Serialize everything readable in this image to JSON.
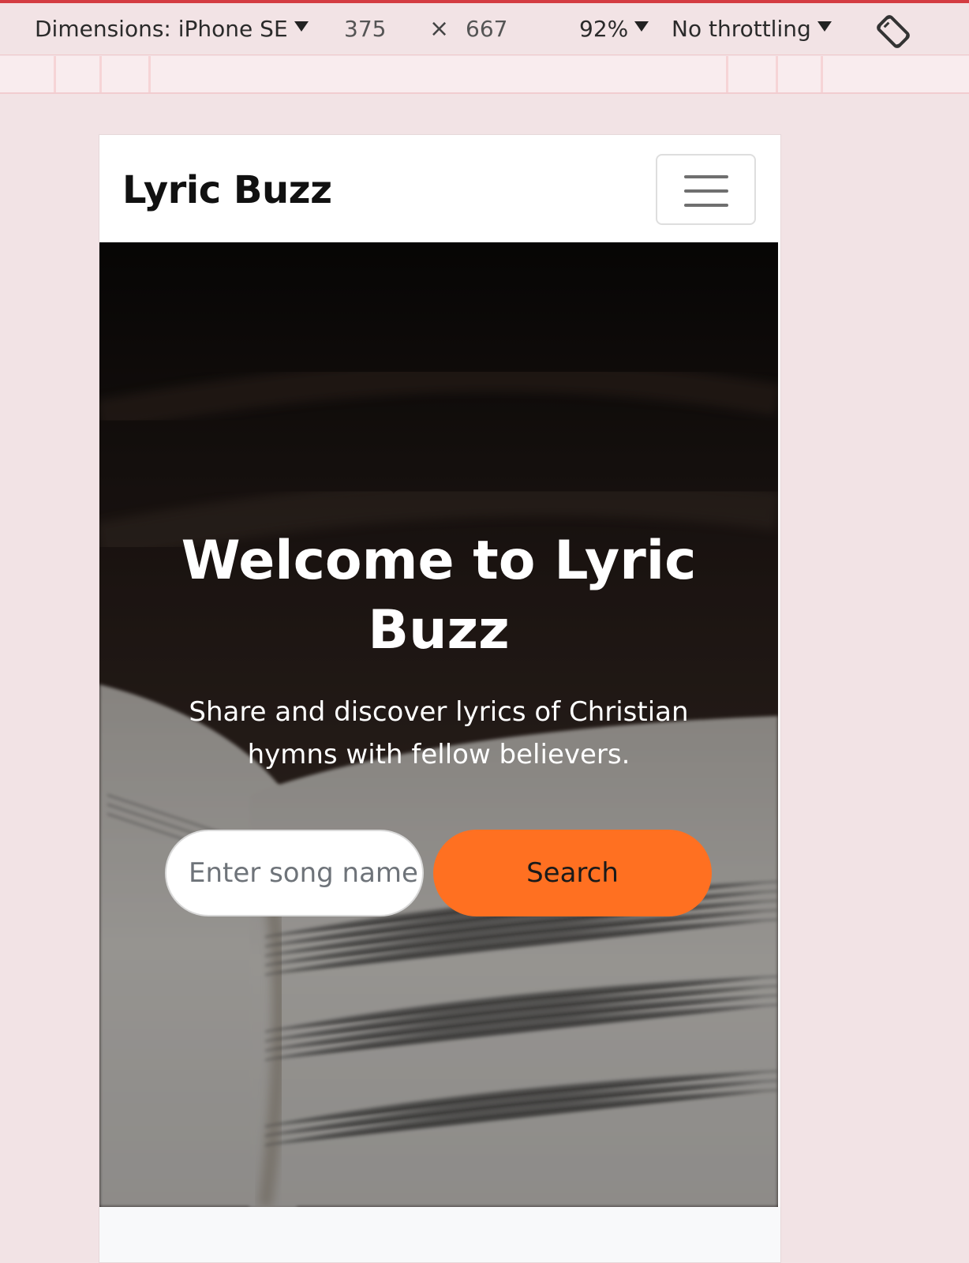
{
  "devtools": {
    "dimensions_label": "Dimensions: iPhone SE",
    "width_value": "375",
    "times": "×",
    "height_value": "667",
    "zoom": "92%",
    "throttling": "No throttling",
    "rotate_icon": "rotate-device-icon"
  },
  "page": {
    "brand": "Lyric Buzz",
    "menu_icon": "hamburger-menu-icon",
    "hero": {
      "title": "Welcome to Lyric Buzz",
      "subtitle": "Share and discover lyrics of Christian hymns with fellow believers.",
      "search_placeholder": "Enter song name",
      "search_button": "Search"
    }
  },
  "colors": {
    "accent": "#ff7021",
    "devtools_top_line": "#d43c42"
  }
}
